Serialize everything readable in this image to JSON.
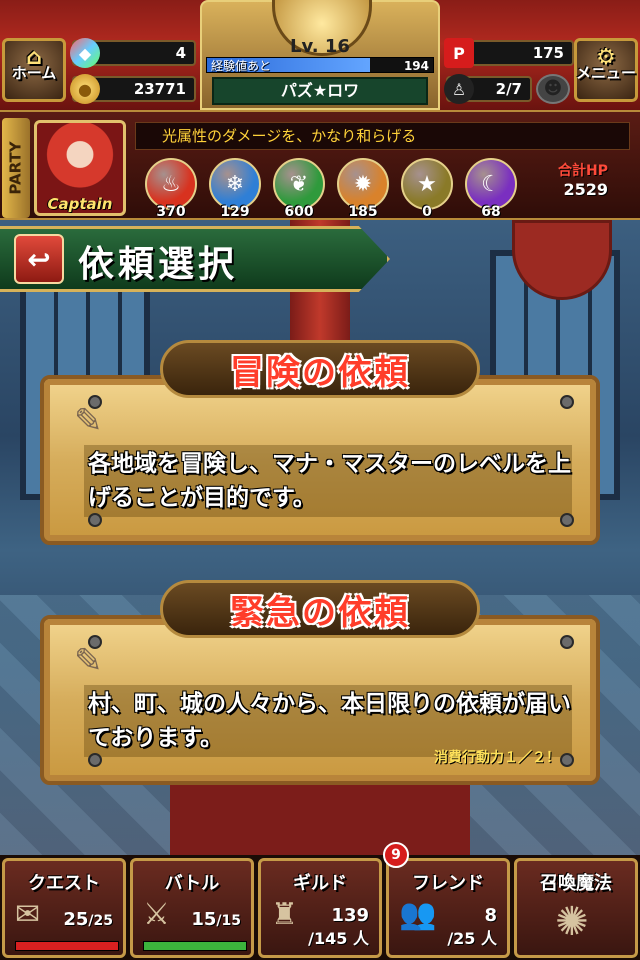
{
  "header": {
    "home_label": "ホーム",
    "menu_label": "メニュー",
    "gems": "4",
    "gold": "23771",
    "level_label": "Lv. 16",
    "exp_label": "経験値あと",
    "exp_remaining": "194",
    "exp_progress": 0.72,
    "player_name": "パズ★ロワ",
    "stamina": "175",
    "party_count": "2/7"
  },
  "party": {
    "tab_label": "PARTY",
    "leader_label": "Captain",
    "skill_text": "光属性のダメージを、かなり和らげる",
    "orbs": [
      {
        "icon": "fire-orb-icon",
        "value": "370",
        "color": "#d8321f"
      },
      {
        "icon": "water-orb-icon",
        "value": "129",
        "color": "#2f7fd6"
      },
      {
        "icon": "wind-orb-icon",
        "value": "600",
        "color": "#2f9a3c"
      },
      {
        "icon": "light-orb-icon",
        "value": "185",
        "color": "#d9822b"
      },
      {
        "icon": "earth-orb-icon",
        "value": "0",
        "color": "#8a7a28"
      },
      {
        "icon": "dark-orb-icon",
        "value": "68",
        "color": "#7a2fc0"
      }
    ],
    "hp_label": "合計HP",
    "hp_value": "2529"
  },
  "page": {
    "title": "依頼選択"
  },
  "quests": [
    {
      "title": "冒険の依頼",
      "description": "各地域を冒険し、マナ・マスターのレベルを上げることが目的です。",
      "note": ""
    },
    {
      "title": "緊急の依頼",
      "description": "村、町、城の人々から、本日限りの依頼が届いております。",
      "note": "消費行動力１／２！"
    }
  ],
  "nav": {
    "quest": {
      "label": "クエスト",
      "current": "25",
      "max": "/25",
      "progress": 1.0,
      "bar_color": "#d82020"
    },
    "battle": {
      "label": "バトル",
      "current": "15",
      "max": "/15",
      "progress": 1.0,
      "bar_color": "#3cb43c"
    },
    "guild": {
      "label": "ギルド",
      "members": "139",
      "max": "/145 人"
    },
    "friend": {
      "label": "フレンド",
      "members": "8",
      "max": "/25 人",
      "badge": "9"
    },
    "summon": {
      "label": "召喚魔法"
    }
  }
}
